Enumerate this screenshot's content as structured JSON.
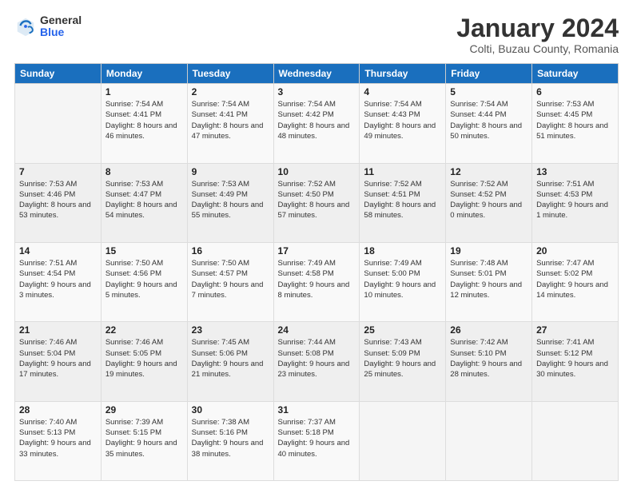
{
  "header": {
    "logo_general": "General",
    "logo_blue": "Blue",
    "month_title": "January 2024",
    "subtitle": "Colti, Buzau County, Romania"
  },
  "days_of_week": [
    "Sunday",
    "Monday",
    "Tuesday",
    "Wednesday",
    "Thursday",
    "Friday",
    "Saturday"
  ],
  "weeks": [
    [
      {
        "day": "",
        "sunrise": "",
        "sunset": "",
        "daylight": ""
      },
      {
        "day": "1",
        "sunrise": "Sunrise: 7:54 AM",
        "sunset": "Sunset: 4:41 PM",
        "daylight": "Daylight: 8 hours and 46 minutes."
      },
      {
        "day": "2",
        "sunrise": "Sunrise: 7:54 AM",
        "sunset": "Sunset: 4:41 PM",
        "daylight": "Daylight: 8 hours and 47 minutes."
      },
      {
        "day": "3",
        "sunrise": "Sunrise: 7:54 AM",
        "sunset": "Sunset: 4:42 PM",
        "daylight": "Daylight: 8 hours and 48 minutes."
      },
      {
        "day": "4",
        "sunrise": "Sunrise: 7:54 AM",
        "sunset": "Sunset: 4:43 PM",
        "daylight": "Daylight: 8 hours and 49 minutes."
      },
      {
        "day": "5",
        "sunrise": "Sunrise: 7:54 AM",
        "sunset": "Sunset: 4:44 PM",
        "daylight": "Daylight: 8 hours and 50 minutes."
      },
      {
        "day": "6",
        "sunrise": "Sunrise: 7:53 AM",
        "sunset": "Sunset: 4:45 PM",
        "daylight": "Daylight: 8 hours and 51 minutes."
      }
    ],
    [
      {
        "day": "7",
        "sunrise": "Sunrise: 7:53 AM",
        "sunset": "Sunset: 4:46 PM",
        "daylight": "Daylight: 8 hours and 53 minutes."
      },
      {
        "day": "8",
        "sunrise": "Sunrise: 7:53 AM",
        "sunset": "Sunset: 4:47 PM",
        "daylight": "Daylight: 8 hours and 54 minutes."
      },
      {
        "day": "9",
        "sunrise": "Sunrise: 7:53 AM",
        "sunset": "Sunset: 4:49 PM",
        "daylight": "Daylight: 8 hours and 55 minutes."
      },
      {
        "day": "10",
        "sunrise": "Sunrise: 7:52 AM",
        "sunset": "Sunset: 4:50 PM",
        "daylight": "Daylight: 8 hours and 57 minutes."
      },
      {
        "day": "11",
        "sunrise": "Sunrise: 7:52 AM",
        "sunset": "Sunset: 4:51 PM",
        "daylight": "Daylight: 8 hours and 58 minutes."
      },
      {
        "day": "12",
        "sunrise": "Sunrise: 7:52 AM",
        "sunset": "Sunset: 4:52 PM",
        "daylight": "Daylight: 9 hours and 0 minutes."
      },
      {
        "day": "13",
        "sunrise": "Sunrise: 7:51 AM",
        "sunset": "Sunset: 4:53 PM",
        "daylight": "Daylight: 9 hours and 1 minute."
      }
    ],
    [
      {
        "day": "14",
        "sunrise": "Sunrise: 7:51 AM",
        "sunset": "Sunset: 4:54 PM",
        "daylight": "Daylight: 9 hours and 3 minutes."
      },
      {
        "day": "15",
        "sunrise": "Sunrise: 7:50 AM",
        "sunset": "Sunset: 4:56 PM",
        "daylight": "Daylight: 9 hours and 5 minutes."
      },
      {
        "day": "16",
        "sunrise": "Sunrise: 7:50 AM",
        "sunset": "Sunset: 4:57 PM",
        "daylight": "Daylight: 9 hours and 7 minutes."
      },
      {
        "day": "17",
        "sunrise": "Sunrise: 7:49 AM",
        "sunset": "Sunset: 4:58 PM",
        "daylight": "Daylight: 9 hours and 8 minutes."
      },
      {
        "day": "18",
        "sunrise": "Sunrise: 7:49 AM",
        "sunset": "Sunset: 5:00 PM",
        "daylight": "Daylight: 9 hours and 10 minutes."
      },
      {
        "day": "19",
        "sunrise": "Sunrise: 7:48 AM",
        "sunset": "Sunset: 5:01 PM",
        "daylight": "Daylight: 9 hours and 12 minutes."
      },
      {
        "day": "20",
        "sunrise": "Sunrise: 7:47 AM",
        "sunset": "Sunset: 5:02 PM",
        "daylight": "Daylight: 9 hours and 14 minutes."
      }
    ],
    [
      {
        "day": "21",
        "sunrise": "Sunrise: 7:46 AM",
        "sunset": "Sunset: 5:04 PM",
        "daylight": "Daylight: 9 hours and 17 minutes."
      },
      {
        "day": "22",
        "sunrise": "Sunrise: 7:46 AM",
        "sunset": "Sunset: 5:05 PM",
        "daylight": "Daylight: 9 hours and 19 minutes."
      },
      {
        "day": "23",
        "sunrise": "Sunrise: 7:45 AM",
        "sunset": "Sunset: 5:06 PM",
        "daylight": "Daylight: 9 hours and 21 minutes."
      },
      {
        "day": "24",
        "sunrise": "Sunrise: 7:44 AM",
        "sunset": "Sunset: 5:08 PM",
        "daylight": "Daylight: 9 hours and 23 minutes."
      },
      {
        "day": "25",
        "sunrise": "Sunrise: 7:43 AM",
        "sunset": "Sunset: 5:09 PM",
        "daylight": "Daylight: 9 hours and 25 minutes."
      },
      {
        "day": "26",
        "sunrise": "Sunrise: 7:42 AM",
        "sunset": "Sunset: 5:10 PM",
        "daylight": "Daylight: 9 hours and 28 minutes."
      },
      {
        "day": "27",
        "sunrise": "Sunrise: 7:41 AM",
        "sunset": "Sunset: 5:12 PM",
        "daylight": "Daylight: 9 hours and 30 minutes."
      }
    ],
    [
      {
        "day": "28",
        "sunrise": "Sunrise: 7:40 AM",
        "sunset": "Sunset: 5:13 PM",
        "daylight": "Daylight: 9 hours and 33 minutes."
      },
      {
        "day": "29",
        "sunrise": "Sunrise: 7:39 AM",
        "sunset": "Sunset: 5:15 PM",
        "daylight": "Daylight: 9 hours and 35 minutes."
      },
      {
        "day": "30",
        "sunrise": "Sunrise: 7:38 AM",
        "sunset": "Sunset: 5:16 PM",
        "daylight": "Daylight: 9 hours and 38 minutes."
      },
      {
        "day": "31",
        "sunrise": "Sunrise: 7:37 AM",
        "sunset": "Sunset: 5:18 PM",
        "daylight": "Daylight: 9 hours and 40 minutes."
      },
      {
        "day": "",
        "sunrise": "",
        "sunset": "",
        "daylight": ""
      },
      {
        "day": "",
        "sunrise": "",
        "sunset": "",
        "daylight": ""
      },
      {
        "day": "",
        "sunrise": "",
        "sunset": "",
        "daylight": ""
      }
    ]
  ]
}
